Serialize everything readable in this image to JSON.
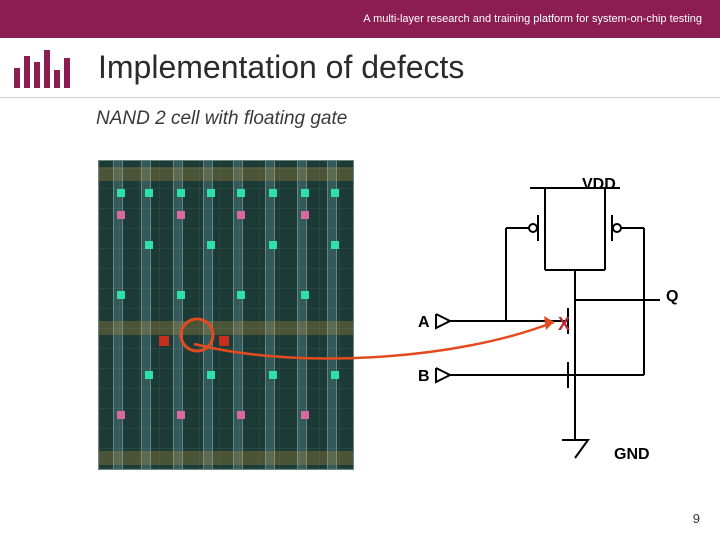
{
  "banner": {
    "subtitle": "A multi-layer research and training platform for system-on-chip testing"
  },
  "title": "Implementation of defects",
  "subtitle": "NAND 2 cell with floating gate",
  "schematic": {
    "vdd": "VDD",
    "gnd": "GND",
    "q": "Q",
    "a": "A",
    "b": "B",
    "defect_mark": "X"
  },
  "page_number": "9"
}
